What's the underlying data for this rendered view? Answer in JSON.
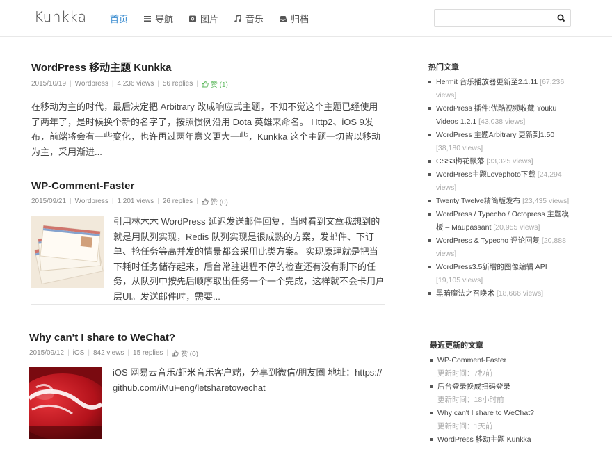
{
  "site": {
    "logo": "Kunkka"
  },
  "nav": [
    {
      "label": "首页",
      "icon": "none",
      "active": true
    },
    {
      "label": "导航",
      "icon": "list-icon"
    },
    {
      "label": "图片",
      "icon": "camera-icon"
    },
    {
      "label": "音乐",
      "icon": "music-note-icon"
    },
    {
      "label": "归档",
      "icon": "inbox-icon"
    }
  ],
  "search": {
    "value": "",
    "placeholder": ""
  },
  "posts": [
    {
      "title": "WordPress 移动主题 Kunkka",
      "date": "2015/10/19",
      "category": "Wordpress",
      "views": "4,236 views",
      "replies": "56 replies",
      "likes": "赞 (1)",
      "excerpt": "在移动为主的时代，最后决定把 Arbitrary 改成响应式主题，不知不觉这个主题已经使用了两年了，是时候换个新的名字了，按照惯例沿用 Dota 英雄来命名。 Http2、iOS 9发布，前端将会有一些变化，也许再过两年意义更大一些，Kunkka 这个主题一切皆以移动为主，采用渐进..."
    },
    {
      "title": "WP-Comment-Faster",
      "date": "2015/09/21",
      "category": "Wordpress",
      "views": "1,201 views",
      "replies": "26 replies",
      "likes": "赞 (0)",
      "excerpt": "引用林木木 WordPress 延迟发送邮件回复，当时看到文章我想到的就是用队列实现，Redis 队列实现是很成熟的方案，发邮件、下订单、抢任务等高并发的情景都会采用此类方案。 实现原理就是把当下耗时任务储存起来，后台常驻进程不停的检查还有没有剩下的任务，从队列中按先后顺序取出任务一个一个完成，这样就不会卡用户层UI。发送邮件时，需要..."
    },
    {
      "title": "Why can't I share to WeChat?",
      "date": "2015/09/12",
      "category": "iOS",
      "views": "842 views",
      "replies": "15 replies",
      "likes": "赞 (0)",
      "excerpt": "iOS 网易云音乐/虾米音乐客户端，分享到微信/朋友圈 地址：https://github.com/iMuFeng/letsharetowechat"
    }
  ],
  "sidebar": {
    "hot_title": "热门文章",
    "hot": [
      {
        "title": "Hermit 音乐播放器更新至2.1.11",
        "views": "[67,236 views]"
      },
      {
        "title": "WordPress 插件:优酷视频收藏 Youku Videos 1.2.1",
        "views": "[43,038 views]"
      },
      {
        "title": "WordPress 主题Arbitrary 更新到1.50",
        "views": "[38,180 views]"
      },
      {
        "title": "CSS3梅花飘落",
        "views": "[33,325 views]"
      },
      {
        "title": "WordPress主题Lovephoto下载",
        "views": "[24,294 views]"
      },
      {
        "title": "Twenty Twelve精简版发布",
        "views": "[23,435 views]"
      },
      {
        "title": "WordPress / Typecho / Octopress 主题模板 – Maupassant",
        "views": "[20,955 views]"
      },
      {
        "title": "WordPress & Typecho 评论回复",
        "views": "[20,888 views]"
      },
      {
        "title": "WordPress3.5新增的图像编辑 API",
        "views": "[19,105 views]"
      },
      {
        "title": "黑暗魔法之召唤术",
        "views": "[18,666 views]"
      }
    ],
    "recent_title": "最近更新的文章",
    "recent": [
      {
        "title": "WP-Comment-Faster",
        "time": "更新时间：7秒前"
      },
      {
        "title": "后台登录换成扫码登录",
        "time": "更新时间：18小时前"
      },
      {
        "title": "Why can't I share to WeChat?",
        "time": "更新时间：1天前"
      },
      {
        "title": "WordPress 移动主题 Kunkka",
        "time": ""
      }
    ]
  }
}
